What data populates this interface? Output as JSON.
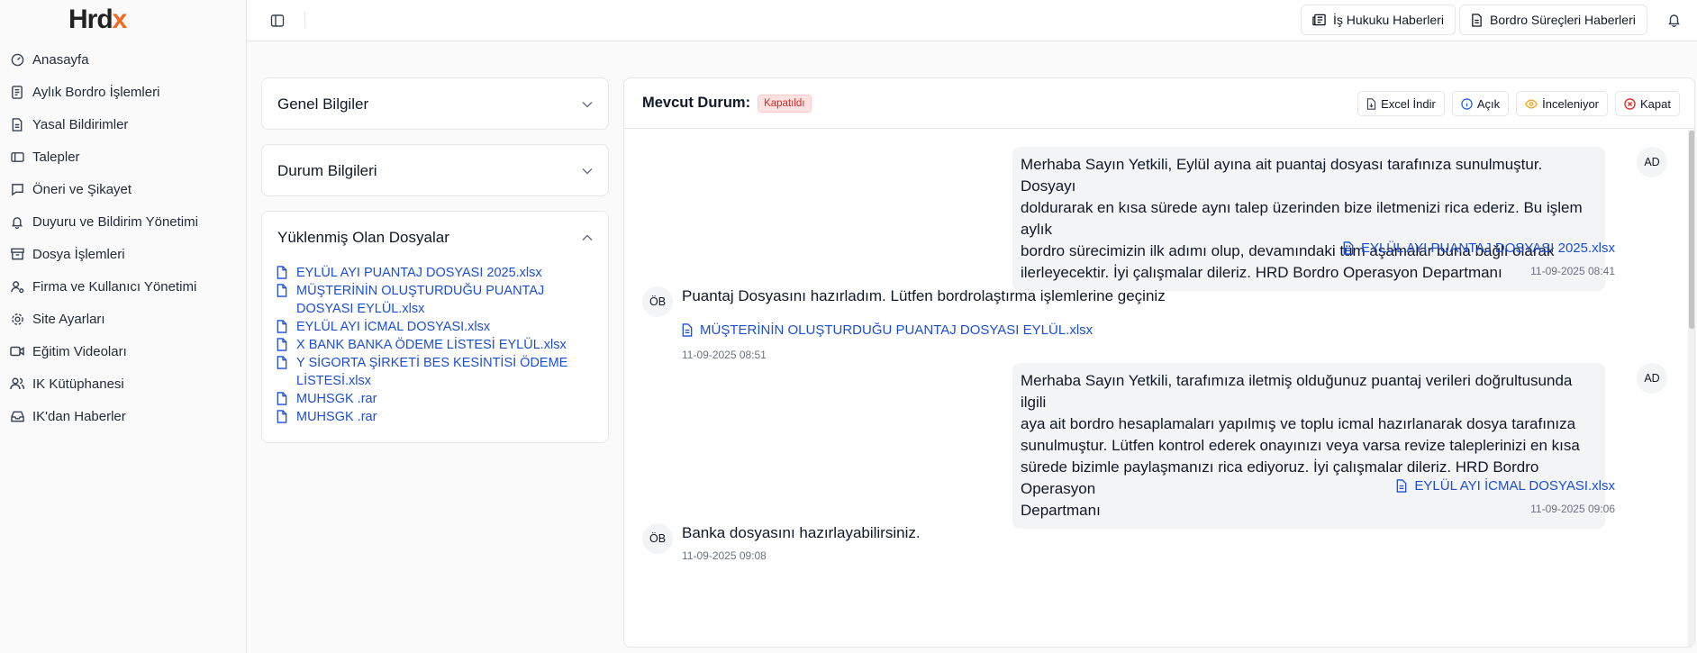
{
  "brand": {
    "logo_main": "Hrd",
    "logo_accent": "x",
    "accent_color": "#f26a21"
  },
  "sidebar": {
    "items": [
      {
        "label": "Anasayfa",
        "icon": "dashboard-icon"
      },
      {
        "label": "Aylık Bordro İşlemleri",
        "icon": "document-icon"
      },
      {
        "label": "Yasal Bildirimler",
        "icon": "document-icon"
      },
      {
        "label": "Talepler",
        "icon": "ticket-icon"
      },
      {
        "label": "Öneri ve Şikayet",
        "icon": "message-icon"
      },
      {
        "label": "Duyuru ve Bildirim Yönetimi",
        "icon": "bell-icon"
      },
      {
        "label": "Dosya İşlemleri",
        "icon": "archive-icon"
      },
      {
        "label": "Firma ve Kullanıcı Yönetimi",
        "icon": "user-settings-icon"
      },
      {
        "label": "Site Ayarları",
        "icon": "gear-icon"
      },
      {
        "label": "Eğitim Videoları",
        "icon": "video-icon"
      },
      {
        "label": "IK Kütüphanesi",
        "icon": "users-icon"
      },
      {
        "label": "IK'dan Haberler",
        "icon": "inbox-icon"
      }
    ]
  },
  "topbar": {
    "news1": "İş Hukuku Haberleri",
    "news2": "Bordro Süreçleri Haberleri"
  },
  "accordions": {
    "general": "Genel Bilgiler",
    "status": "Durum Bilgileri",
    "files_title": "Yüklenmiş Olan Dosyalar",
    "files": [
      {
        "l1": "EYLÜL AYI PUANTAJ DOSYASI 2025.xlsx",
        "l2": ""
      },
      {
        "l1": "MÜŞTERİNİN OLUŞTURDUĞU PUANTAJ",
        "l2": "DOSYASI EYLÜL.xlsx"
      },
      {
        "l1": "EYLÜL AYI İCMAL DOSYASI.xlsx",
        "l2": ""
      },
      {
        "l1": "X BANK BANKA ÖDEME LİSTESİ EYLÜL.xlsx",
        "l2": ""
      },
      {
        "l1": "Y SİGORTA ŞİRKETİ BES KESİNTİSİ ÖDEME",
        "l2": "LİSTESİ.xlsx"
      },
      {
        "l1": "MUHSGK .rar",
        "l2": ""
      },
      {
        "l1": "MUHSGK .rar",
        "l2": ""
      }
    ]
  },
  "main": {
    "status_label": "Mevcut Durum:",
    "status_value": "Kapatıldı",
    "buttons": {
      "excel": "Excel İndir",
      "open": "Açık",
      "review": "İnceleniyor",
      "close": "Kapat"
    },
    "messages": [
      {
        "avatar": "AD",
        "lines": [
          "Merhaba Sayın Yetkili, Eylül ayına ait puantaj dosyası tarafınıza sunulmuştur. Dosyayı",
          "doldurarak en kısa sürede aynı talep üzerinden bize iletmenizi rica ederiz. Bu işlem aylık",
          "bordro sürecimizin ilk adımı olup, devamındaki tüm aşamalar buna bağlı olarak",
          "ilerleyecektir. İyi çalışmalar dileriz. HRD Bordro Operasyon Departmanı"
        ],
        "file": "EYLÜL AYI PUANTAJ DOSYASI 2025.xlsx",
        "time": "11-09-2025 08:41"
      },
      {
        "avatar": "ÖB",
        "text": "Puantaj Dosyasını hazırladım. Lütfen bordrolaştırma işlemlerine geçiniz",
        "file": "MÜŞTERİNİN OLUŞTURDUĞU PUANTAJ DOSYASI EYLÜL.xlsx",
        "time": "11-09-2025 08:51"
      },
      {
        "avatar": "AD",
        "lines": [
          "Merhaba Sayın Yetkili, tarafımıza iletmiş olduğunuz puantaj verileri doğrultusunda ilgili",
          "aya ait bordro hesaplamaları yapılmış ve toplu icmal hazırlanarak dosya tarafınıza",
          "sunulmuştur. Lütfen kontrol ederek onayınızı veya varsa revize taleplerinizi en kısa",
          "sürede bizimle paylaşmanızı rica ediyoruz. İyi çalışmalar dileriz. HRD Bordro Operasyon",
          "Departmanı"
        ],
        "file": "EYLÜL AYI İCMAL DOSYASI.xlsx",
        "time": "11-09-2025 09:06"
      },
      {
        "avatar": "ÖB",
        "text": "Banka dosyasını hazırlayabilirsiniz.",
        "time": "11-09-2025 09:08"
      }
    ]
  }
}
